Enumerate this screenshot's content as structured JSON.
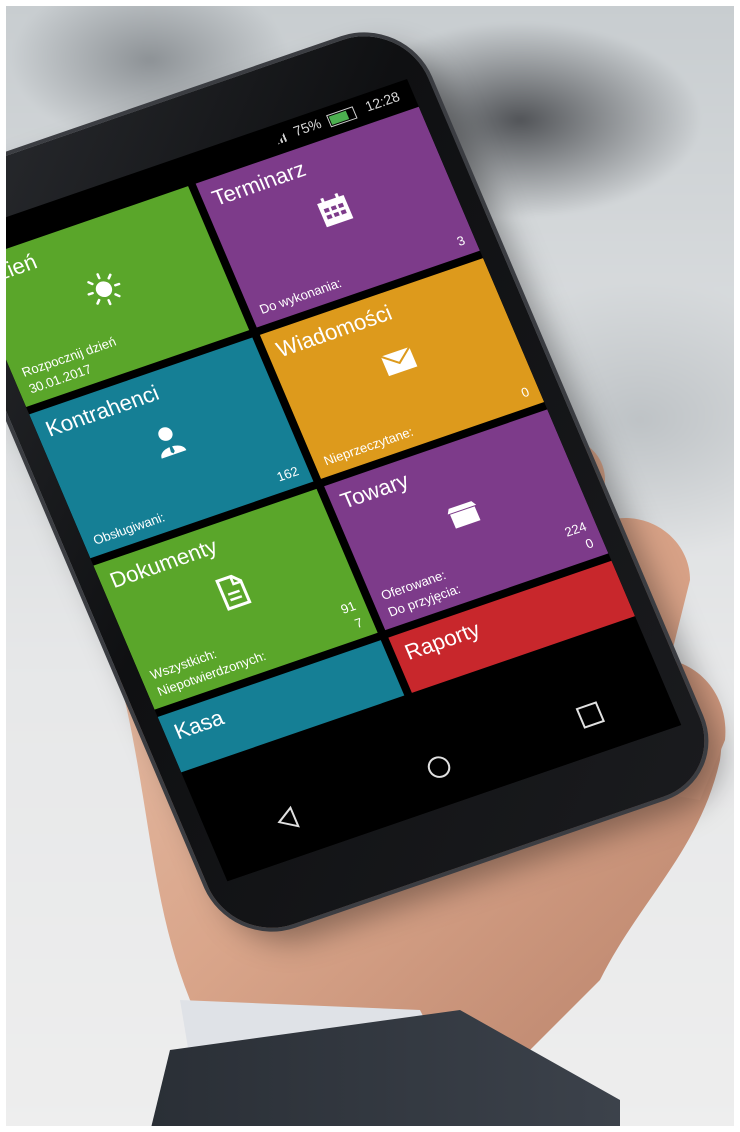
{
  "status_bar": {
    "battery": "75%",
    "time": "12:28"
  },
  "tiles": [
    {
      "title": "Dzień",
      "icon": "sun-icon",
      "color": "#5aa62a",
      "stat1_label": "Rozpocznij dzień",
      "stat1_value": "",
      "stat2_label": "30.01.2017",
      "stat2_value": ""
    },
    {
      "title": "Terminarz",
      "icon": "calendar-icon",
      "color": "#7d3b8a",
      "stat1_label": "",
      "stat1_value": "",
      "stat2_label": "Do wykonania:",
      "stat2_value": "3"
    },
    {
      "title": "Kontrahenci",
      "icon": "user-icon",
      "color": "#157f95",
      "stat1_label": "",
      "stat1_value": "",
      "stat2_label": "Obsługiwani:",
      "stat2_value": "162"
    },
    {
      "title": "Wiadomości",
      "icon": "envelope-icon",
      "color": "#dd9a1c",
      "stat1_label": "",
      "stat1_value": "",
      "stat2_label": "Nieprzeczytane:",
      "stat2_value": "0"
    },
    {
      "title": "Dokumenty",
      "icon": "document-icon",
      "color": "#5aa62a",
      "stat1_label": "Wszystkich:",
      "stat1_value": "91",
      "stat2_label": "Niepotwierdzonych:",
      "stat2_value": "7"
    },
    {
      "title": "Towary",
      "icon": "box-icon",
      "color": "#7d3b8a",
      "stat1_label": "Oferowane:",
      "stat1_value": "224",
      "stat2_label": "Do przyjęcia:",
      "stat2_value": "0"
    },
    {
      "title": "Kasa",
      "icon": "",
      "color": "#157f95"
    },
    {
      "title": "Raporty",
      "icon": "",
      "color": "#c8272c"
    }
  ]
}
